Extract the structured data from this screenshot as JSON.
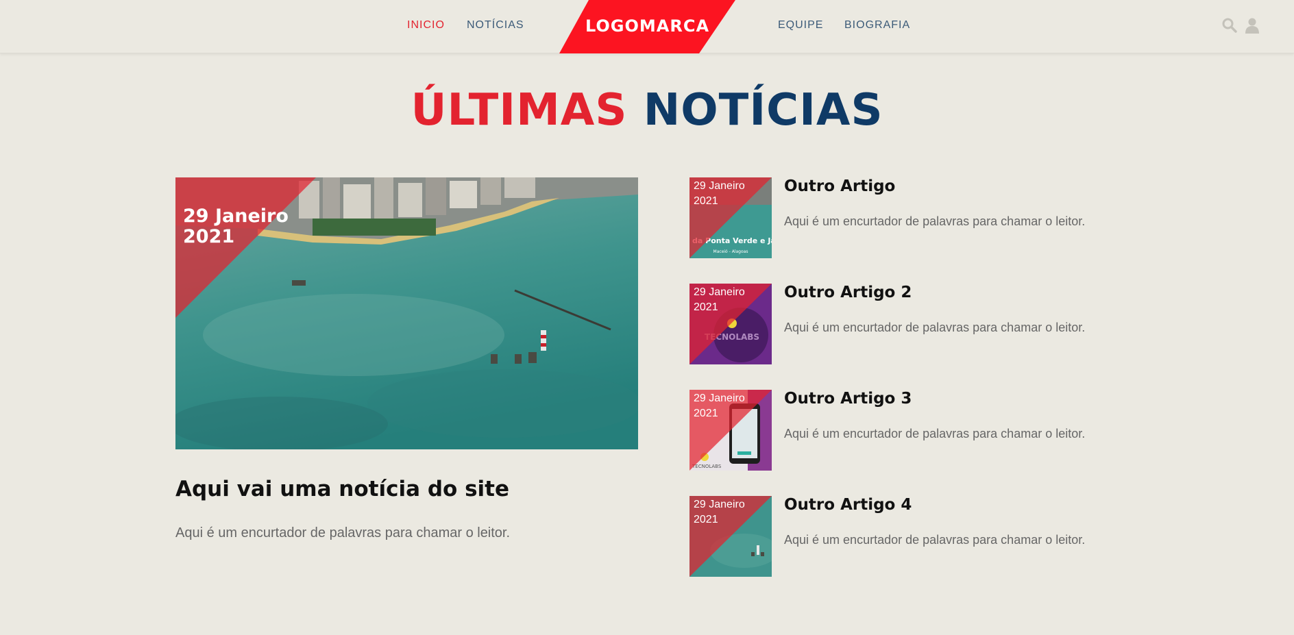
{
  "header": {
    "nav_left": [
      "INICIO",
      "NOTÍCIAS"
    ],
    "nav_right": [
      "EQUIPE",
      "BIOGRAFIA"
    ],
    "logo_text": "LOGOMARCA",
    "icons": [
      "search-icon",
      "user-icon"
    ]
  },
  "section": {
    "title_part1": "ÚLTIMAS",
    "title_part2": "NOTÍCIAS"
  },
  "featured": {
    "date_line1": "29 Janeiro",
    "date_line2": "2021",
    "title": "Aqui vai uma notícia do site",
    "excerpt": "Aqui é um encurtador de palavras para chamar o leitor."
  },
  "articles": [
    {
      "date_line1": "29 Janeiro",
      "date_line2": "2021",
      "title": "Outro Artigo",
      "excerpt": "Aqui é um encurtador de palavras para chamar o leitor.",
      "thumb_caption": "da Ponta Verde e Ja",
      "thumb_subcaption": "Maceió - Alagoas"
    },
    {
      "date_line1": "29 Janeiro",
      "date_line2": "2021",
      "title": "Outro Artigo 2",
      "excerpt": "Aqui é um encurtador de palavras para chamar o leitor.",
      "thumb_caption": "TECNOLABS"
    },
    {
      "date_line1": "29 Janeiro",
      "date_line2": "2021",
      "title": "Outro Artigo 3",
      "excerpt": "Aqui é um encurtador de palavras para chamar o leitor.",
      "thumb_caption": "TECNOLABS"
    },
    {
      "date_line1": "29 Janeiro",
      "date_line2": "2021",
      "title": "Outro Artigo 4",
      "excerpt": "Aqui é um encurtador de palavras para chamar o leitor."
    }
  ],
  "colors": {
    "accent_red": "#e3232f",
    "title_blue": "#0f3a66",
    "nav_blue": "#3b5a78",
    "background": "#ebe9e1"
  }
}
